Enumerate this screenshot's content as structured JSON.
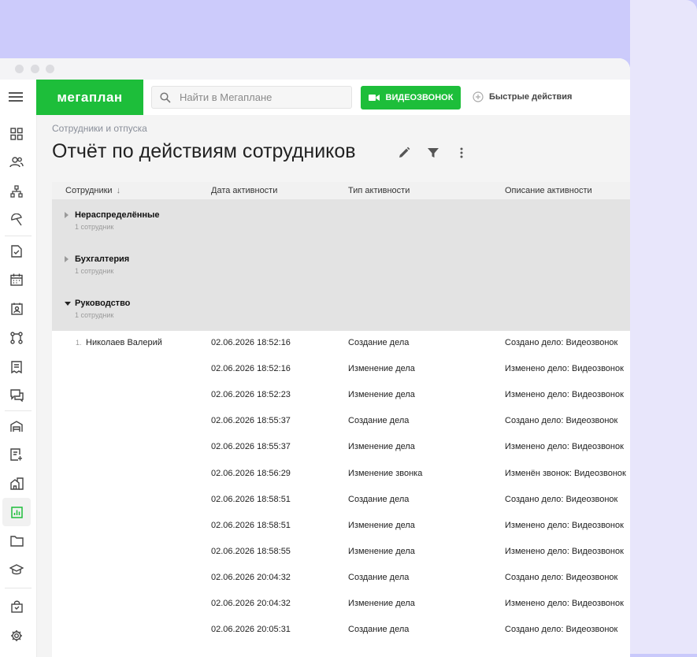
{
  "app": {
    "logo_text": "мегаплан",
    "brand_color": "#1dbe3a"
  },
  "search": {
    "placeholder": "Найти в Мегаплане",
    "value": ""
  },
  "header": {
    "video_call_label": "ВИДЕОЗВОНОК",
    "quick_actions_label": "Быстрые действия"
  },
  "sidebar": {
    "items": [
      {
        "icon": "dashboard-icon"
      },
      {
        "icon": "users-icon"
      },
      {
        "icon": "org-structure-icon"
      },
      {
        "icon": "vacation-umbrella-icon"
      },
      {
        "icon": "task-document-icon"
      },
      {
        "icon": "calendar-icon"
      },
      {
        "icon": "contacts-icon"
      },
      {
        "icon": "workflow-icon"
      },
      {
        "icon": "invoice-icon"
      },
      {
        "icon": "chat-icon"
      },
      {
        "icon": "warehouse-icon"
      },
      {
        "icon": "add-document-icon"
      },
      {
        "icon": "real-estate-icon"
      },
      {
        "icon": "reports-icon",
        "active": true
      },
      {
        "icon": "folder-icon"
      },
      {
        "icon": "education-icon"
      },
      {
        "icon": "shopping-bag-icon"
      },
      {
        "icon": "settings-gear-icon"
      }
    ]
  },
  "page": {
    "breadcrumb": "Сотрудники и отпуска",
    "title": "Отчёт по действиям сотрудников"
  },
  "table": {
    "columns": [
      "Сотрудники",
      "Дата активности",
      "Тип активности",
      "Описание активности"
    ],
    "sort_indicator": "↓",
    "groups": [
      {
        "name": "Нераспределённые",
        "count": "1 сотрудник",
        "expanded": false
      },
      {
        "name": "Бухгалтерия",
        "count": "1 сотрудник",
        "expanded": false
      },
      {
        "name": "Руководство",
        "count": "1 сотрудник",
        "expanded": true
      }
    ],
    "employee": {
      "number": "1.",
      "name": "Николаев Валерий"
    },
    "rows": [
      {
        "date": "02.06.2026 18:52:16",
        "type": "Создание дела",
        "desc": "Создано дело: Видеозвонок"
      },
      {
        "date": "02.06.2026 18:52:16",
        "type": "Изменение дела",
        "desc": "Изменено дело: Видеозвонок"
      },
      {
        "date": "02.06.2026 18:52:23",
        "type": "Изменение дела",
        "desc": "Изменено дело: Видеозвонок"
      },
      {
        "date": "02.06.2026 18:55:37",
        "type": "Создание дела",
        "desc": "Создано дело: Видеозвонок"
      },
      {
        "date": "02.06.2026 18:55:37",
        "type": "Изменение дела",
        "desc": "Изменено дело: Видеозвонок"
      },
      {
        "date": "02.06.2026 18:56:29",
        "type": "Изменение звонка",
        "desc": "Изменён звонок: Видеозвонок"
      },
      {
        "date": "02.06.2026 18:58:51",
        "type": "Создание дела",
        "desc": "Создано дело: Видеозвонок"
      },
      {
        "date": "02.06.2026 18:58:51",
        "type": "Изменение дела",
        "desc": "Изменено дело: Видеозвонок"
      },
      {
        "date": "02.06.2026 18:58:55",
        "type": "Изменение дела",
        "desc": "Изменено дело: Видеозвонок"
      },
      {
        "date": "02.06.2026 20:04:32",
        "type": "Создание дела",
        "desc": "Создано дело: Видеозвонок"
      },
      {
        "date": "02.06.2026 20:04:32",
        "type": "Изменение дела",
        "desc": "Изменено дело: Видеозвонок"
      },
      {
        "date": "02.06.2026 20:05:31",
        "type": "Создание дела",
        "desc": "Создано дело: Видеозвонок"
      }
    ]
  }
}
